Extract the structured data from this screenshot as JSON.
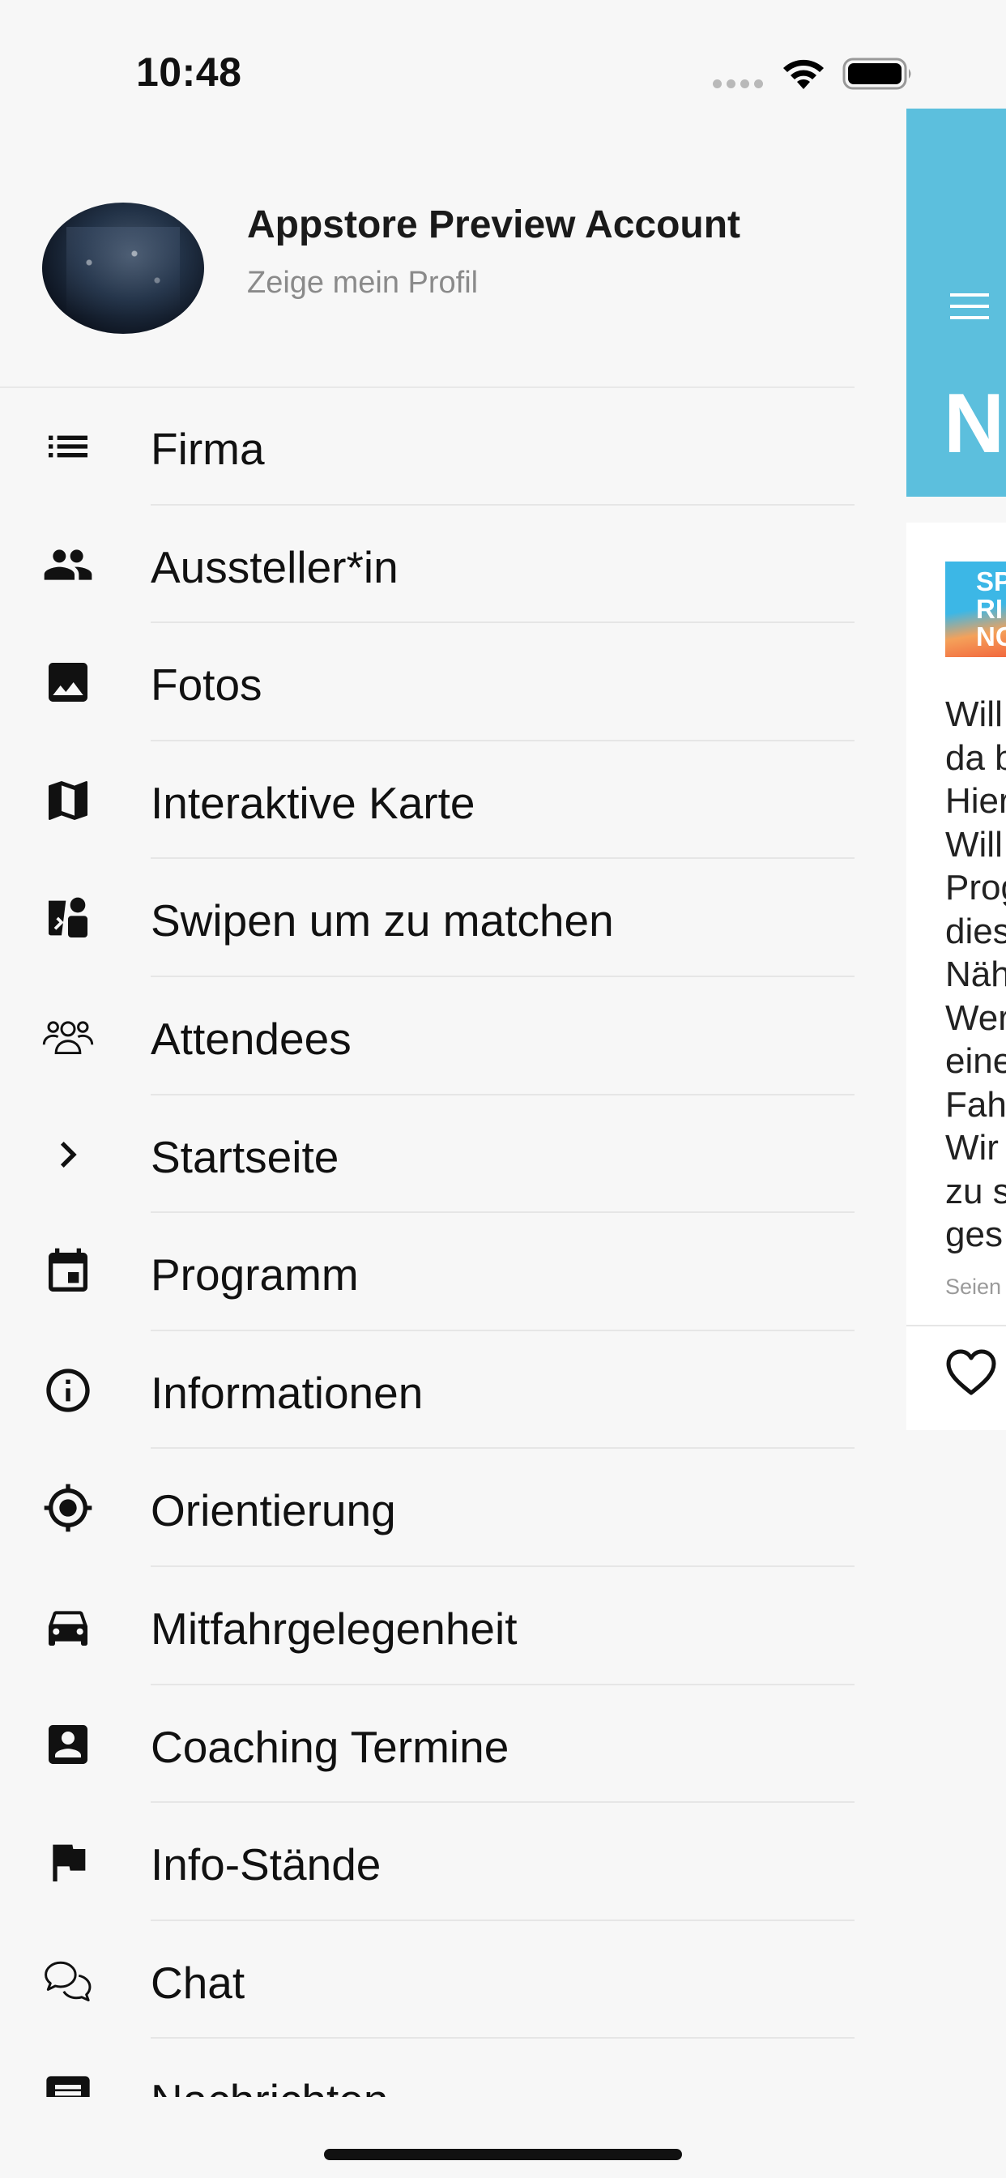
{
  "status_bar": {
    "time": "10:48"
  },
  "profile": {
    "name": "Appstore Preview Account",
    "subtitle": "Zeige mein Profil"
  },
  "menu": {
    "items": [
      {
        "label": "Firma",
        "icon": "list-icon"
      },
      {
        "label": "Aussteller*in",
        "icon": "people-icon"
      },
      {
        "label": "Fotos",
        "icon": "image-icon"
      },
      {
        "label": "Interaktive Karte",
        "icon": "map-icon"
      },
      {
        "label": "Swipen um zu matchen",
        "icon": "swipe-match-icon"
      },
      {
        "label": "Attendees",
        "icon": "attendees-icon"
      },
      {
        "label": "Startseite",
        "icon": "chevron-right-icon"
      },
      {
        "label": "Programm",
        "icon": "calendar-icon"
      },
      {
        "label": "Informationen",
        "icon": "info-icon"
      },
      {
        "label": "Orientierung",
        "icon": "location-target-icon"
      },
      {
        "label": "Mitfahrgelegenheit",
        "icon": "car-icon"
      },
      {
        "label": "Coaching Termine",
        "icon": "contact-card-icon"
      },
      {
        "label": "Info-Stände",
        "icon": "flag-icon"
      },
      {
        "label": "Chat",
        "icon": "chat-icon"
      },
      {
        "label": "Nachrichten",
        "icon": "message-icon"
      }
    ]
  },
  "background_feed": {
    "header_title_fragment": "N",
    "card": {
      "logo_text_fragment": "SP\nRI\nNC",
      "text_fragment": "Will\nda b\nHier\nWill\nProg\ndies\nNäh\nWer\neine\nFah\nWir \nzu s\nges",
      "meta_fragment": "Seien"
    }
  },
  "colors": {
    "drawer_background": "#f7f7f7",
    "header_accent": "#5cbfdd",
    "text_primary": "#111111",
    "text_secondary": "#8a8a8a"
  }
}
